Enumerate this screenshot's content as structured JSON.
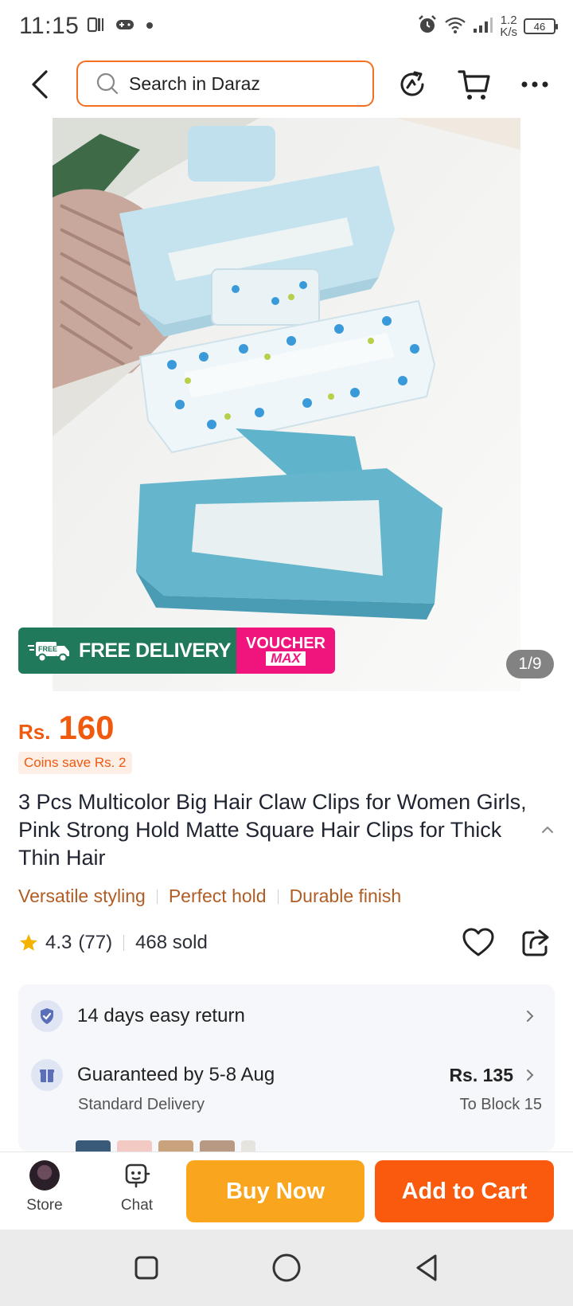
{
  "status_bar": {
    "time": "11:15",
    "net_speed_value": "1.2",
    "net_speed_unit": "K/s",
    "battery": "46"
  },
  "nav": {
    "search_placeholder": "Search in Daraz"
  },
  "gallery": {
    "promo_free_label": "FREE",
    "promo_free_text": "FREE DELIVERY",
    "promo_voucher_top": "VOUCHER",
    "promo_voucher_bottom": "MAX",
    "counter": "1/9"
  },
  "product": {
    "currency": "Rs.",
    "price": "160",
    "coins": "Coins save Rs. 2",
    "title": "3 Pcs Multicolor Big Hair Claw Clips for Women Girls, Pink Strong Hold Matte Square Hair Clips for Thick Thin Hair",
    "features": [
      "Versatile styling",
      "Perfect hold",
      "Durable finish"
    ],
    "rating": "4.3",
    "reviews": "(77)",
    "sold": "468 sold"
  },
  "services": {
    "return_text": "14 days easy return",
    "delivery_text": "Guaranteed by 5-8 Aug",
    "delivery_sub": "Standard Delivery",
    "delivery_price": "Rs. 135",
    "delivery_location": "To Block 15"
  },
  "bottom_bar": {
    "store_label": "Store",
    "chat_label": "Chat",
    "buy_now": "Buy Now",
    "add_to_cart": "Add to Cart"
  },
  "colors": {
    "brand_orange": "#f36f21",
    "buy_now": "#f9a51d",
    "add_to_cart": "#f95a0d",
    "free_delivery_green": "#20795a",
    "voucher_pink": "#f0157d"
  }
}
